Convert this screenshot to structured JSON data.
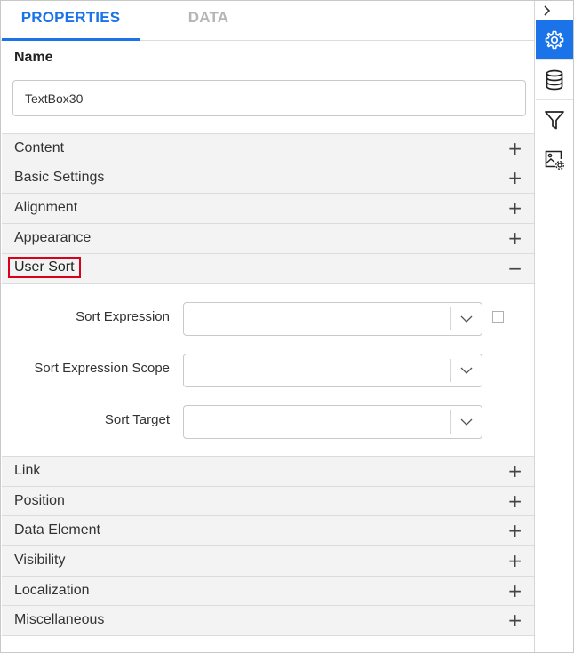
{
  "tabs": [
    {
      "label": "PROPERTIES",
      "active": true
    },
    {
      "label": "DATA",
      "active": false
    }
  ],
  "name": {
    "label": "Name",
    "value": "TextBox30"
  },
  "sections_top": [
    {
      "label": "Content",
      "toggle": "+"
    },
    {
      "label": "Basic Settings",
      "toggle": "+"
    },
    {
      "label": "Alignment",
      "toggle": "+"
    },
    {
      "label": "Appearance",
      "toggle": "+"
    }
  ],
  "user_sort": {
    "label": "User Sort",
    "toggle": "−",
    "fields": [
      {
        "label": "Sort Expression",
        "value": ""
      },
      {
        "label": "Sort Expression Scope",
        "value": ""
      },
      {
        "label": "Sort Target",
        "value": ""
      }
    ],
    "checkbox_checked": false
  },
  "sections_bottom": [
    {
      "label": "Link",
      "toggle": "+"
    },
    {
      "label": "Position",
      "toggle": "+"
    },
    {
      "label": "Data Element",
      "toggle": "+"
    },
    {
      "label": "Visibility",
      "toggle": "+"
    },
    {
      "label": "Localization",
      "toggle": "+"
    },
    {
      "label": "Miscellaneous",
      "toggle": "+"
    }
  ],
  "rail": {
    "collapse_icon": "chevron-right-icon",
    "items": [
      {
        "icon": "gear-icon",
        "active": true
      },
      {
        "icon": "database-icon",
        "active": false
      },
      {
        "icon": "filter-icon",
        "active": false
      },
      {
        "icon": "image-settings-icon",
        "active": false
      }
    ]
  },
  "colors": {
    "accent": "#1a73e8",
    "highlight_border": "#d9001b",
    "section_bg": "#f3f3f3"
  }
}
